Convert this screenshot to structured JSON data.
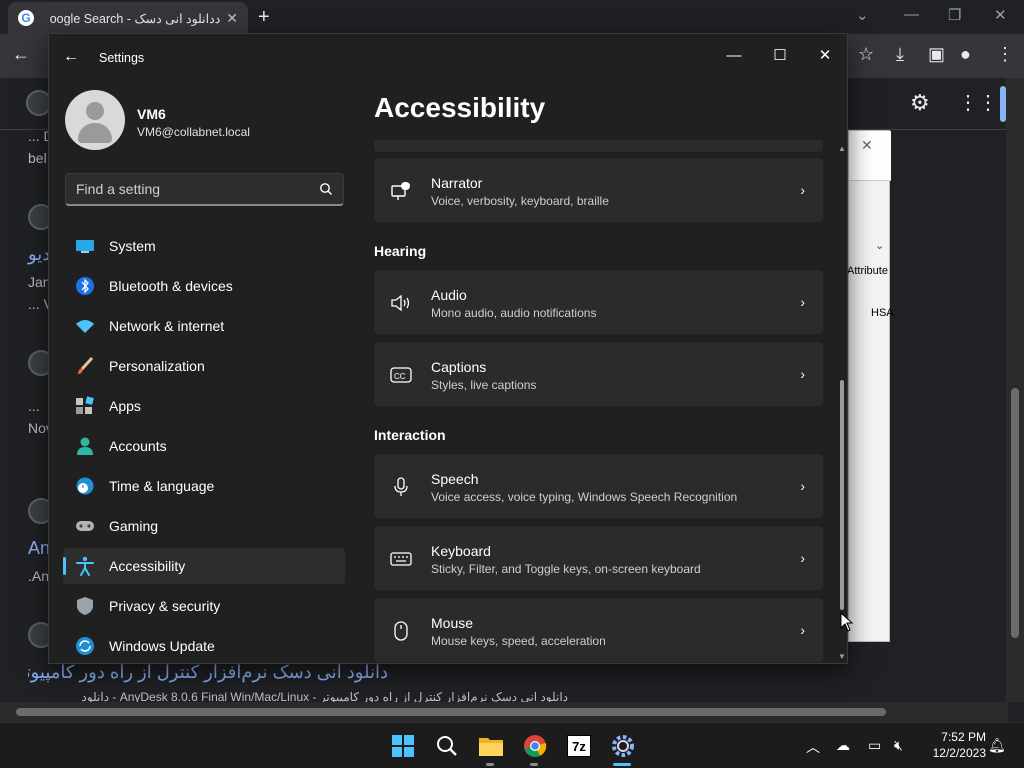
{
  "browser": {
    "tab_title": "ددانلود انی دسک - oogle Search",
    "tab_close": "✕",
    "new_tab": "+",
    "bg_results": [
      "... D",
      "bel",
      "دیو",
      "Jan",
      "... V",
      "...",
      "Nov",
      "An",
      ".An",
      "دانلود انی دسک نرم‌افزار کنترل از راه دور کامپیوتر",
      "دانلود انی دسک نرم‌افزار کنترل از راه دور کامپیوتر - AnyDesk 8.0.6 Final Win/Mac/Linux - دانلود"
    ]
  },
  "dialog_behind": {
    "close": "✕",
    "text1": "Attribute",
    "text2": "HSA"
  },
  "settings": {
    "app_title": "Settings",
    "account": {
      "name": "VM6",
      "email": "VM6@collabnet.local"
    },
    "search": {
      "placeholder": "Find a setting"
    },
    "nav": [
      {
        "label": "System",
        "icon": "system-icon"
      },
      {
        "label": "Bluetooth & devices",
        "icon": "bluetooth-icon"
      },
      {
        "label": "Network & internet",
        "icon": "network-icon"
      },
      {
        "label": "Personalization",
        "icon": "brush-icon"
      },
      {
        "label": "Apps",
        "icon": "apps-icon"
      },
      {
        "label": "Accounts",
        "icon": "accounts-icon"
      },
      {
        "label": "Time & language",
        "icon": "time-language-icon"
      },
      {
        "label": "Gaming",
        "icon": "gaming-icon"
      },
      {
        "label": "Accessibility",
        "icon": "accessibility-icon",
        "active": true
      },
      {
        "label": "Privacy & security",
        "icon": "shield-icon"
      },
      {
        "label": "Windows Update",
        "icon": "update-icon"
      }
    ],
    "page_title": "Accessibility",
    "sections": {
      "hearing": "Hearing",
      "interaction": "Interaction"
    },
    "cards": {
      "narrator": {
        "title": "Narrator",
        "sub": "Voice, verbosity, keyboard, braille"
      },
      "audio": {
        "title": "Audio",
        "sub": "Mono audio, audio notifications"
      },
      "captions": {
        "title": "Captions",
        "sub": "Styles, live captions"
      },
      "speech": {
        "title": "Speech",
        "sub": "Voice access, voice typing, Windows Speech Recognition"
      },
      "keyboard": {
        "title": "Keyboard",
        "sub": "Sticky, Filter, and Toggle keys, on-screen keyboard"
      },
      "mouse": {
        "title": "Mouse",
        "sub": "Mouse keys, speed, acceleration"
      }
    },
    "chevron": "›"
  },
  "taskbar": {
    "apps": [
      "start-icon",
      "search-icon",
      "file-explorer-icon",
      "chrome-icon",
      "7zip-icon",
      "settings-icon"
    ],
    "zip_label": "7z",
    "clock": {
      "time": "7:52 PM",
      "date": "12/2/2023"
    }
  },
  "colors": {
    "accent": "#4cc2ff",
    "background": "#202020",
    "card": "#2b2b2b"
  }
}
